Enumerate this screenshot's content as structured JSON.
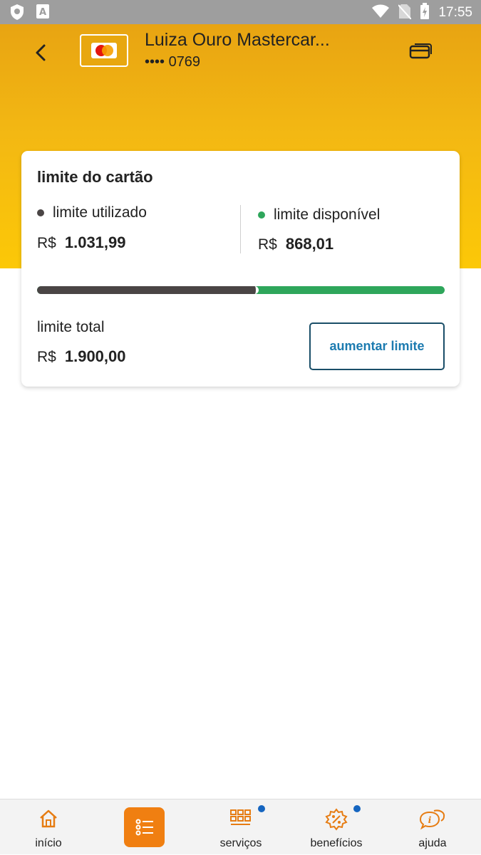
{
  "status_bar": {
    "time": "17:55"
  },
  "header": {
    "card_name": "Luiza Ouro Mastercar...",
    "card_number": "•••• 0769"
  },
  "limit_card": {
    "title": "limite do cartão",
    "used": {
      "label": "limite utilizado",
      "currency": "R$",
      "value": "1.031,99",
      "dot_color": "#4a4545"
    },
    "available": {
      "label": "limite disponível",
      "currency": "R$",
      "value": "868,01",
      "dot_color": "#2ea65b"
    },
    "used_fraction": 0.543,
    "total": {
      "label": "limite total",
      "currency": "R$",
      "value": "1.900,00"
    },
    "increase_button": "aumentar limite"
  },
  "bottom_nav": {
    "items": [
      {
        "label": "início",
        "icon": "home-icon"
      },
      {
        "label": "",
        "icon": "menu-list-icon",
        "active": true
      },
      {
        "label": "serviços",
        "icon": "grid-icon",
        "notification": true
      },
      {
        "label": "benefícios",
        "icon": "discount-badge-icon",
        "notification": true
      },
      {
        "label": "ajuda",
        "icon": "help-chat-icon"
      }
    ]
  },
  "colors": {
    "header_top": "#e8a412",
    "header_bottom": "#fcc807",
    "accent_orange": "#f07f11",
    "available_green": "#2ea65b",
    "used_gray": "#4a4545",
    "button_text": "#1c7bb0",
    "notification_blue": "#1565c0"
  }
}
